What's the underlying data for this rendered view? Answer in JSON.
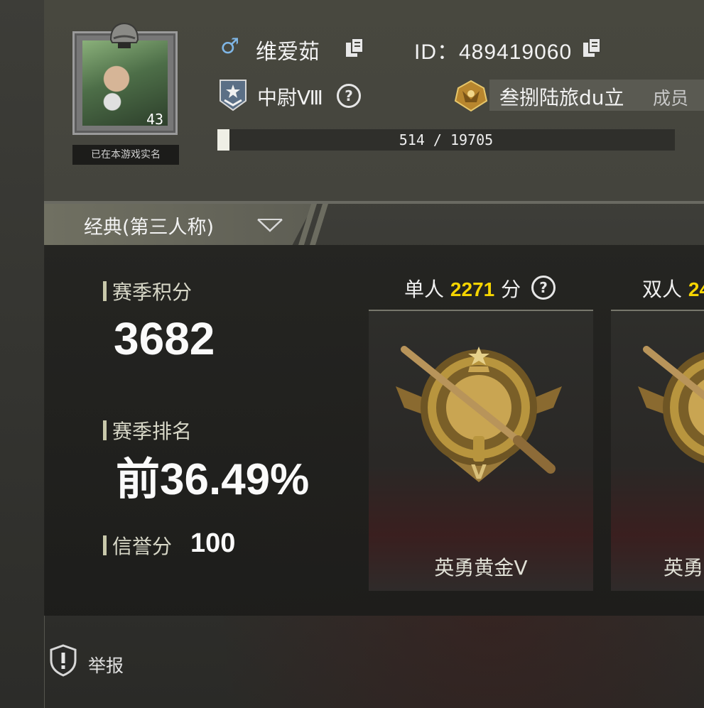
{
  "profile": {
    "nickname": "维爱茹",
    "gender_icon": "male-symbol-icon",
    "id_text": "ID：489419060",
    "level": "43",
    "realname_note": "已在本游戏实名",
    "rank": "中尉Ⅷ",
    "clan_name": "叁捌陆旅du立",
    "clan_role": "成员",
    "xp_text": "514 / 19705",
    "xp_fraction": 0.026
  },
  "mode": {
    "label": "经典(第三人称)"
  },
  "stats": {
    "season_score_label": "赛季积分",
    "season_score": "3682",
    "season_rank_label": "赛季排名",
    "season_rank": "前36.49%",
    "honor_label": "信誉分",
    "honor_value": "100"
  },
  "cards": [
    {
      "title": "单人",
      "points": "2271",
      "suffix": "分",
      "tier": "英勇黄金Ⅴ"
    },
    {
      "title": "双人",
      "points": "24",
      "suffix": "",
      "tier": "英勇"
    }
  ],
  "footer": {
    "report_label": "举报"
  },
  "colors": {
    "accent_yellow": "#f5d400",
    "gender_blue": "#7fb6e6"
  }
}
